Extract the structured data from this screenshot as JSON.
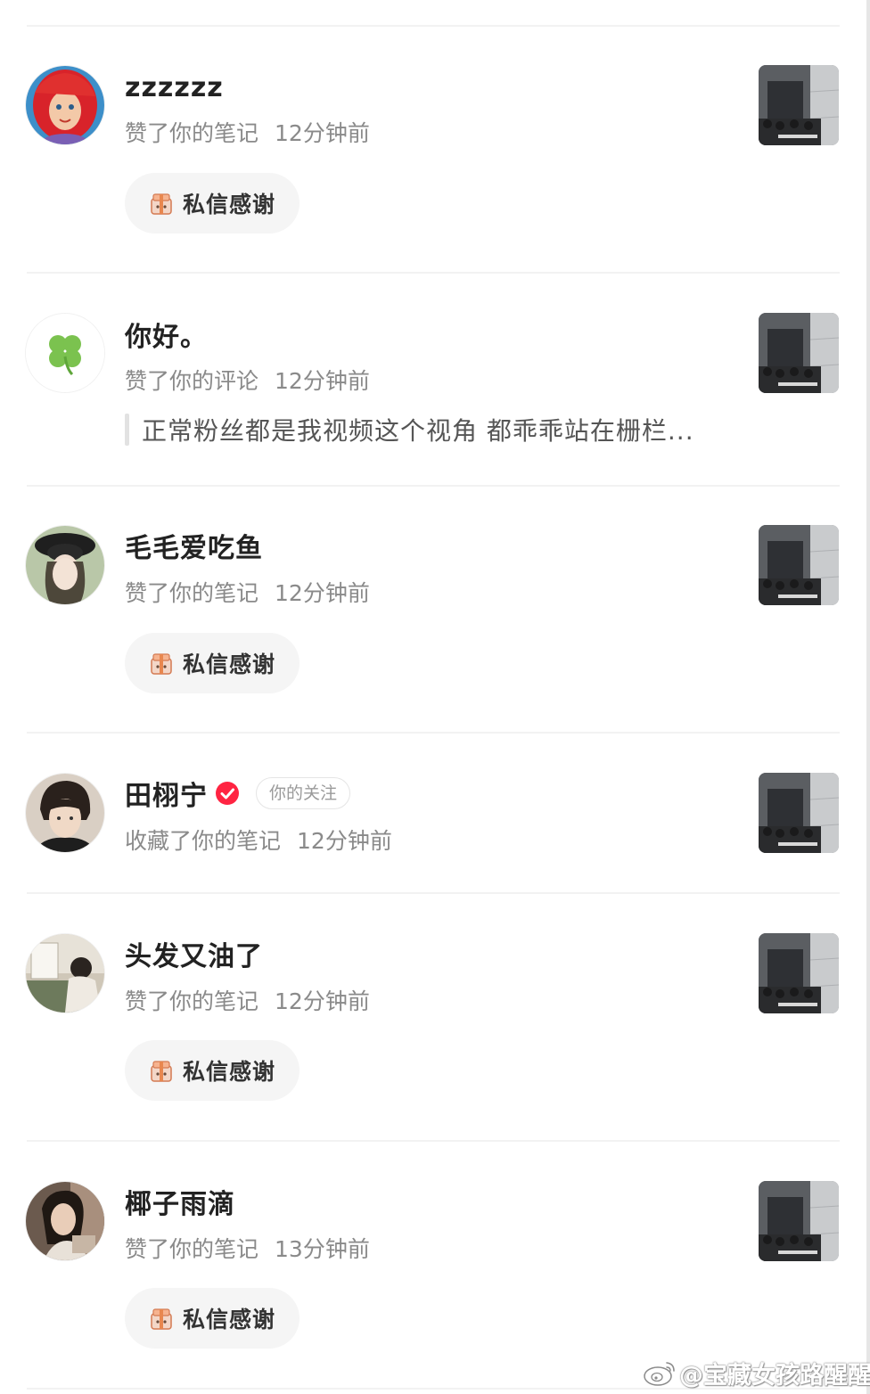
{
  "notifications": [
    {
      "name": "zzzzzz",
      "action": "赞了你的笔记",
      "time": "12分钟前",
      "thank_label": "私信感谢",
      "avatar_icon": "mermaid-avatar"
    },
    {
      "name": "你好。",
      "action": "赞了你的评论",
      "time": "12分钟前",
      "comment": "正常粉丝都是我视频这个视角 都乖乖站在栅栏...",
      "avatar_icon": "clover-avatar"
    },
    {
      "name": "毛毛爱吃鱼",
      "action": "赞了你的笔记",
      "time": "12分钟前",
      "thank_label": "私信感谢",
      "avatar_icon": "girl-hat-avatar"
    },
    {
      "name": "田栩宁",
      "action": "收藏了你的笔记",
      "time": "12分钟前",
      "follow_tag": "你的关注",
      "verified": true,
      "avatar_icon": "person-avatar"
    },
    {
      "name": "头发又油了",
      "action": "赞了你的笔记",
      "time": "12分钟前",
      "thank_label": "私信感谢",
      "avatar_icon": "drawing-avatar"
    },
    {
      "name": "椰子雨滴",
      "action": "赞了你的笔记",
      "time": "13分钟前",
      "thank_label": "私信感谢",
      "avatar_icon": "girl-avatar"
    }
  ],
  "watermark": {
    "text": "@宝藏女孩路醒醒",
    "icon": "weibo-icon"
  },
  "colors": {
    "verified": "#ff2442",
    "divider": "#f2f2f2",
    "button_bg": "#f5f5f5",
    "meta_text": "#8a8a8a"
  }
}
